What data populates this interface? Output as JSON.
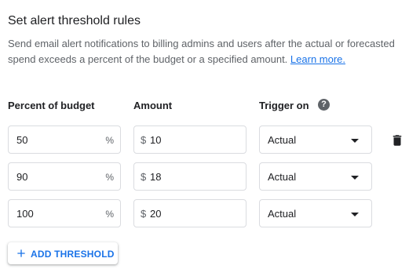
{
  "section": {
    "title": "Set alert threshold rules",
    "description": "Send email alert notifications to billing admins and users after the actual or forecasted spend exceeds a percent of the budget or a specified amount.",
    "learn_more": "Learn more."
  },
  "columns": {
    "percent": "Percent of budget",
    "amount": "Amount",
    "trigger": "Trigger on",
    "help_icon": "?"
  },
  "units": {
    "percent": "%",
    "currency": "$"
  },
  "thresholds": [
    {
      "percent": "50",
      "amount": "10",
      "trigger": "Actual"
    },
    {
      "percent": "90",
      "amount": "18",
      "trigger": "Actual"
    },
    {
      "percent": "100",
      "amount": "20",
      "trigger": "Actual"
    }
  ],
  "add_button": {
    "label": "ADD THRESHOLD",
    "icon": "plus-icon"
  },
  "icons": {
    "delete": "trash-icon",
    "help": "help-icon",
    "dropdown": "caret-down-icon"
  },
  "colors": {
    "accent": "#1a73e8",
    "text": "#202124",
    "muted": "#5f6368",
    "border": "#dadce0"
  }
}
